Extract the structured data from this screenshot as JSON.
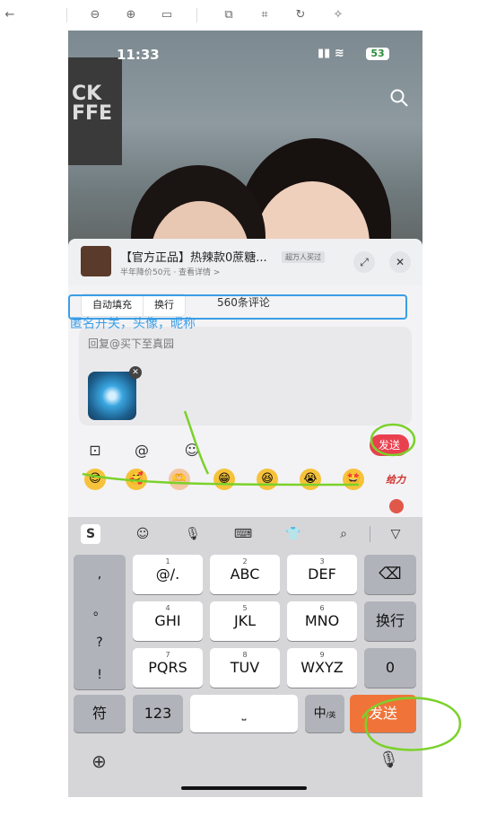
{
  "toolbar": {
    "icons": [
      "back-arrow-icon",
      "zoom-out-icon",
      "zoom-in-icon",
      "fit-icon",
      "copy-icon",
      "scan-icon",
      "rotate-icon",
      "magic-icon"
    ]
  },
  "status": {
    "time": "11:33",
    "battery": "53"
  },
  "photo": {
    "shelf_text": "CK\nFFE"
  },
  "product": {
    "title": "【官方正品】热辣款0蔗糖...",
    "subtitle": "半年降价50元 · 查看详情 >",
    "badge": "超万人买过"
  },
  "comment": {
    "chip_autofill": "自动填充",
    "chip_newline": "换行",
    "count": "560条评论"
  },
  "input": {
    "placeholder": "回复@买下至真园"
  },
  "actions": {
    "send_label": "发送"
  },
  "emoji_row": {
    "last_label": "给力"
  },
  "keyboard": {
    "left_col": [
      ",",
      "。",
      "?",
      "!"
    ],
    "rows": [
      [
        {
          "num": "1",
          "label": "@/."
        },
        {
          "num": "2",
          "label": "ABC"
        },
        {
          "num": "3",
          "label": "DEF"
        }
      ],
      [
        {
          "num": "4",
          "label": "GHI"
        },
        {
          "num": "5",
          "label": "JKL"
        },
        {
          "num": "6",
          "label": "MNO"
        }
      ],
      [
        {
          "num": "7",
          "label": "PQRS"
        },
        {
          "num": "8",
          "label": "TUV"
        },
        {
          "num": "9",
          "label": "WXYZ"
        }
      ]
    ],
    "delete_label": "⌫",
    "newline_label": "换行",
    "zero_label": "0",
    "symbols_label": "符",
    "numbers_label": "123",
    "lang_label": "中",
    "lang_sub": "/英",
    "send_label": "发送"
  },
  "annotation": {
    "text": "匿名开关，头像，昵称"
  },
  "colors": {
    "annotation_blue": "#3a9ee6",
    "annotation_green": "#7bd12a",
    "send_red": "#e9404f",
    "key_orange": "#f07439"
  }
}
